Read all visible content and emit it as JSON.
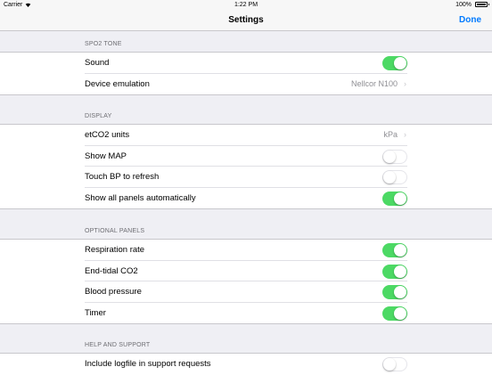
{
  "status_bar": {
    "carrier": "Carrier",
    "time": "1:22 PM",
    "battery": "100%"
  },
  "nav": {
    "title": "Settings",
    "done": "Done"
  },
  "sections": [
    {
      "header": "SPO2 TONE",
      "rows": [
        {
          "label": "Sound",
          "type": "toggle",
          "on": true
        },
        {
          "label": "Device emulation",
          "type": "disclosure",
          "value": "Nellcor N100"
        }
      ]
    },
    {
      "header": "DISPLAY",
      "rows": [
        {
          "label": "etCO2 units",
          "type": "disclosure",
          "value": "kPa"
        },
        {
          "label": "Show MAP",
          "type": "toggle",
          "on": false
        },
        {
          "label": "Touch BP to refresh",
          "type": "toggle",
          "on": false
        },
        {
          "label": "Show all panels automatically",
          "type": "toggle",
          "on": true
        }
      ]
    },
    {
      "header": "OPTIONAL PANELS",
      "rows": [
        {
          "label": "Respiration rate",
          "type": "toggle",
          "on": true
        },
        {
          "label": "End-tidal CO2",
          "type": "toggle",
          "on": true
        },
        {
          "label": "Blood pressure",
          "type": "toggle",
          "on": true
        },
        {
          "label": "Timer",
          "type": "toggle",
          "on": true
        }
      ]
    },
    {
      "header": "HELP AND SUPPORT",
      "rows": [
        {
          "label": "Include logfile in support requests",
          "type": "toggle",
          "on": false
        }
      ]
    }
  ],
  "colors": {
    "accent": "#007aff",
    "toggle_on": "#4cd964",
    "background": "#efeff4"
  }
}
